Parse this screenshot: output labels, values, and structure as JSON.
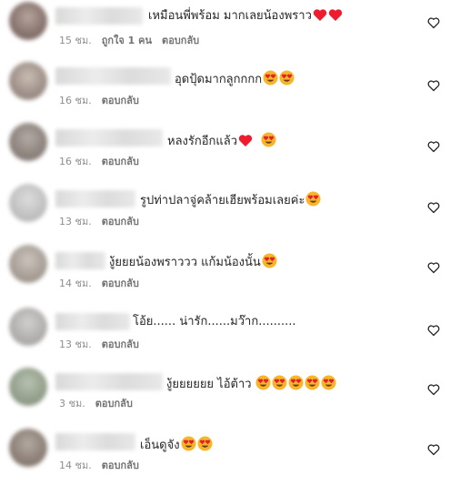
{
  "colors": {
    "text": "#262626",
    "meta": "#8e8e8e",
    "heart_red": "#ed1c2e",
    "emoji_face": "#f7b62a"
  },
  "comments": [
    {
      "text": "เหมือนพี่พร้อม มากเลยน้องพราว",
      "emoji": [
        "red-heart",
        "red-heart"
      ],
      "time": "15 ชม.",
      "likes": "ถูกใจ 1 คน",
      "reply": "ตอบกลับ"
    },
    {
      "text": "อุดปุ้ดมากลูกกกก",
      "emoji": [
        "heart-eyes",
        "heart-eyes"
      ],
      "time": "16 ชม.",
      "likes": "",
      "reply": "ตอบกลับ"
    },
    {
      "text": "หลงรักอีกแล้ว",
      "emoji": [
        "red-heart",
        "heart-eyes"
      ],
      "time": "16 ชม.",
      "likes": "",
      "reply": "ตอบกลับ"
    },
    {
      "text": "รูปท่าปลาจู่คล้ายเฮียพร้อมเลยค่ะ",
      "emoji": [
        "heart-eyes"
      ],
      "time": "13 ชม.",
      "likes": "",
      "reply": "ตอบกลับ"
    },
    {
      "text": "งู้ยยยน้องพราววว แก้มน้องนั้น",
      "emoji": [
        "heart-eyes"
      ],
      "time": "14 ชม.",
      "likes": "",
      "reply": "ตอบกลับ"
    },
    {
      "text": "โอ้ย...... น่ารัก......มว๊าก..........",
      "emoji": [],
      "time": "13 ชม.",
      "likes": "",
      "reply": "ตอบกลับ"
    },
    {
      "text": "งู้ยยยยยย ไอ้ต้าว",
      "emoji": [
        "heart-eyes",
        "heart-eyes",
        "heart-eyes",
        "heart-eyes",
        "heart-eyes"
      ],
      "time": "3 ชม.",
      "likes": "",
      "reply": "ตอบกลับ"
    },
    {
      "text": "เอ็นดูจัง",
      "emoji": [
        "heart-eyes",
        "heart-eyes"
      ],
      "time": "14 ชม.",
      "likes": "",
      "reply": "ตอบกลับ"
    }
  ]
}
